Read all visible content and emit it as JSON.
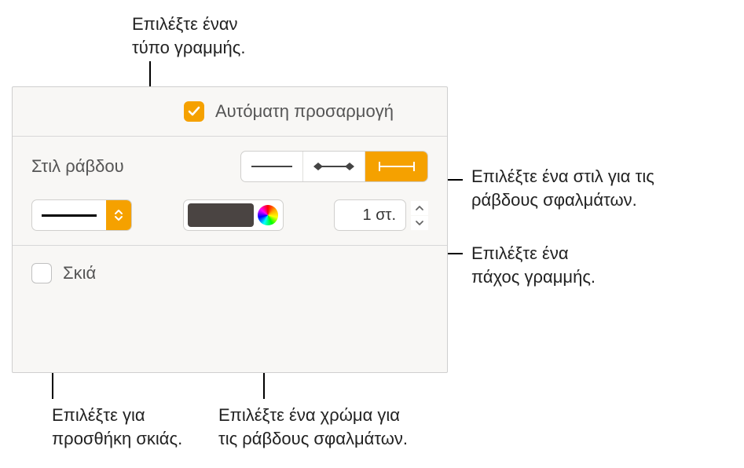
{
  "callouts": {
    "line_type": "Επιλέξτε έναν\nτύπο γραμμής.",
    "bar_style": "Επιλέξτε ένα στιλ για τις\nράβδους σφαλμάτων.",
    "thickness": "Επιλέξτε ένα\nπάχος γραμμής.",
    "shadow": "Επιλέξτε για\nπροσθήκη σκιάς.",
    "color": "Επιλέξτε ένα χρώμα για\nτις ράβδους σφαλμάτων."
  },
  "panel": {
    "auto_adjust": {
      "label": "Αυτόματη προσαρμογή",
      "checked": true
    },
    "bar_style_label": "Στιλ ράβδου",
    "bar_style_options": [
      "plain",
      "diamond-caps",
      "flat-caps"
    ],
    "bar_style_selected": "flat-caps",
    "line_type_selected": "solid",
    "color_selected": "#4a4442",
    "thickness": {
      "value": "1 στ."
    },
    "shadow": {
      "label": "Σκιά",
      "checked": false
    }
  }
}
